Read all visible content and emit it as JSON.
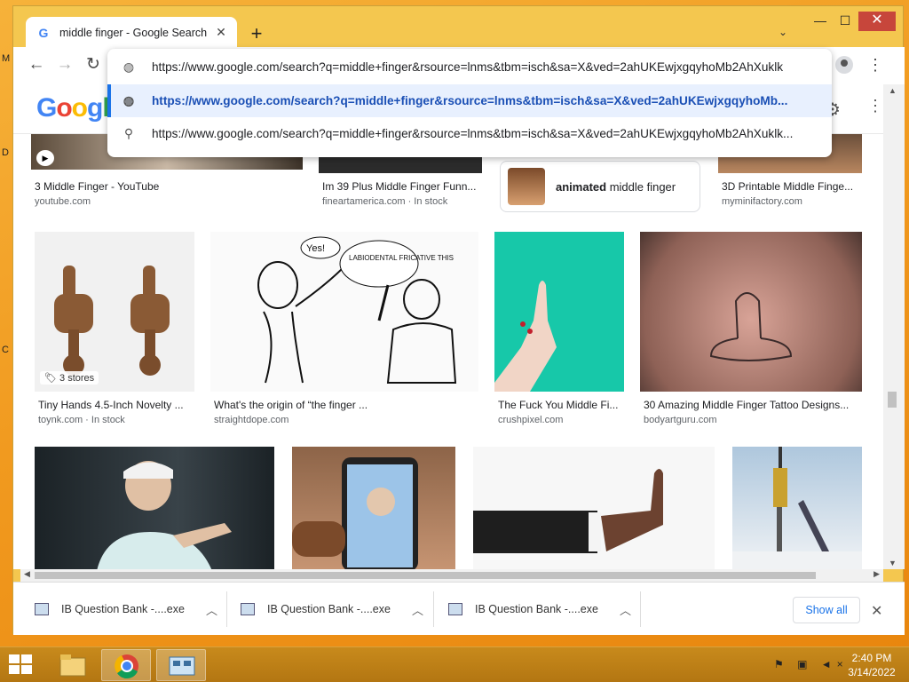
{
  "desktop": {
    "left_glyphs": [
      "M",
      "D",
      "C"
    ]
  },
  "window_controls": {
    "minimize": "—",
    "maximize": "☐",
    "close": "✕"
  },
  "tab": {
    "title": "middle finger - Google Search",
    "close": "✕",
    "new_tab": "+",
    "menu": "⌄"
  },
  "nav": {
    "back": "←",
    "forward": "→",
    "reload": "↻"
  },
  "omnibox": {
    "input_value": "https://www.google.com/search?q=middle+finger&rsource=lnms&tbm=isch&sa=X&ved=2ahUKEwjxgqyhoMb2AhXuklk",
    "suggestions": [
      {
        "icon": "globe-icon",
        "text": "https://www.google.com/search?q=middle+finger&rsource=lnms&tbm=isch&sa=X&ved=2ahUKEwjxgqyhoMb..."
      },
      {
        "icon": "search-icon",
        "text": "https://www.google.com/search?q=middle+finger&rsource=lnms&tbm=isch&sa=X&ved=2ahUKEwjxgqyhoMb2AhXuklk..."
      }
    ]
  },
  "google": {
    "logo": "Google"
  },
  "results": {
    "row1": [
      {
        "caption": "3 Middle Finger - YouTube",
        "source": "youtube.com"
      },
      {
        "caption": "Im 39 Plus Middle Finger Funn...",
        "source": "fineartamerica.com · In stock"
      },
      {
        "caption": "3D Printable Middle Finge...",
        "source": "myminifactory.com"
      }
    ],
    "related": {
      "bold": "animated",
      "rest": " middle finger"
    },
    "row2": [
      {
        "caption": "Tiny Hands 4.5-Inch Novelty ...",
        "source": "toynk.com · In stock",
        "badge": "3 stores"
      },
      {
        "caption": "What's the origin of “the finger ...",
        "source": "straightdope.com"
      },
      {
        "caption": "The Fuck You Middle Fi...",
        "source": "crushpixel.com"
      },
      {
        "caption": "30 Amazing Middle Finger Tattoo Designs...",
        "source": "bodyartguru.com"
      }
    ],
    "cartoon_text": {
      "left": "Yes!",
      "right": "LABIODENTAL FRICATIVE THIS"
    }
  },
  "downloads": {
    "items": [
      {
        "label": "IB Question Bank -....exe"
      },
      {
        "label": "IB Question Bank -....exe"
      },
      {
        "label": "IB Question Bank -....exe"
      }
    ],
    "show_all": "Show all",
    "close": "✕"
  },
  "taskbar": {
    "time": "2:40 PM",
    "date": "3/14/2022"
  }
}
